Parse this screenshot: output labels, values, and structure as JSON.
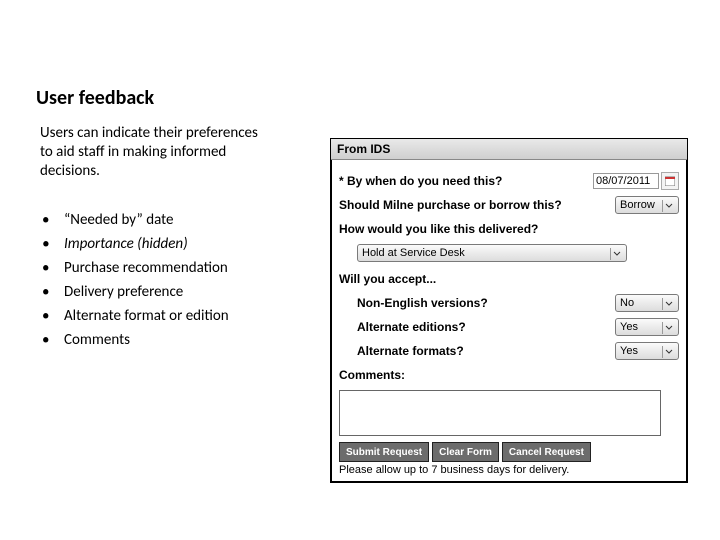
{
  "title": "User feedback",
  "intro": "Users can indicate their preferences to aid staff in making informed decisions.",
  "bullets": [
    "“Needed by” date",
    "Importance (hidden)",
    "Purchase recommendation",
    "Delivery preference",
    "Alternate format or edition",
    "Comments"
  ],
  "form": {
    "header": "From IDS",
    "q_need_by": "* By when do you need this?",
    "date_value": "08/07/2011",
    "q_purchase": "Should Milne purchase or borrow this?",
    "purchase_value": "Borrow",
    "q_delivery": "How would you like this delivered?",
    "delivery_value": "Hold at Service Desk",
    "q_accept": "Will you accept...",
    "q_nonenglish": "Non-English versions?",
    "nonenglish_value": "No",
    "q_alteditions": "Alternate editions?",
    "alteditions_value": "Yes",
    "q_altformats": "Alternate formats?",
    "altformats_value": "Yes",
    "q_comments": "Comments:",
    "btn_submit": "Submit Request",
    "btn_clear": "Clear Form",
    "btn_cancel": "Cancel Request",
    "note": "Please allow up to 7 business days for delivery."
  }
}
